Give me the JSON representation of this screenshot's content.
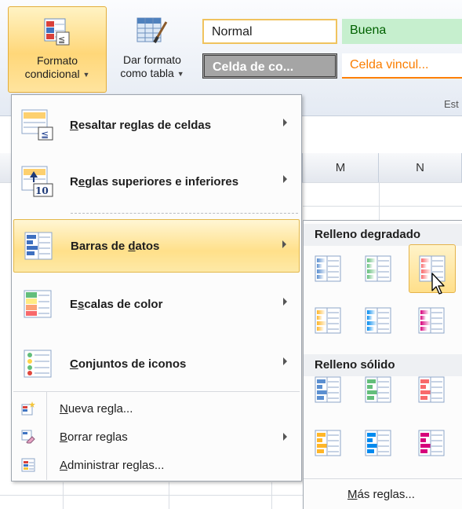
{
  "ribbon": {
    "formato_label_1": "Formato",
    "formato_label_2": "condicional",
    "dar_label_1": "Dar formato",
    "dar_label_2": "como tabla",
    "group_label": "Est"
  },
  "styles": {
    "normal": "Normal",
    "buena": "Buena",
    "celda": "Celda de co...",
    "vinculada": "Celda vincul..."
  },
  "columns": [
    "M",
    "N"
  ],
  "menu": {
    "items": [
      {
        "pre": "",
        "acc": "R",
        "post": "esaltar reglas de celdas",
        "icon": "highlight-cells-rules-icon"
      },
      {
        "pre": "R",
        "acc": "e",
        "post": "glas superiores e inferiores",
        "icon": "top-bottom-rules-icon"
      },
      {
        "pre": "Barras de ",
        "acc": "d",
        "post": "atos",
        "icon": "data-bars-icon"
      },
      {
        "pre": "E",
        "acc": "s",
        "post": "calas de color",
        "icon": "color-scales-icon"
      },
      {
        "pre": "",
        "acc": "C",
        "post": "onjuntos de iconos",
        "icon": "icon-sets-icon"
      }
    ],
    "small_items": [
      {
        "pre": "",
        "acc": "N",
        "post": "ueva regla...",
        "icon": "new-rule-icon"
      },
      {
        "pre": "",
        "acc": "B",
        "post": "orrar reglas",
        "icon": "clear-rules-icon"
      },
      {
        "pre": "",
        "acc": "A",
        "post": "dministrar reglas...",
        "icon": "manage-rules-icon"
      }
    ]
  },
  "submenu": {
    "gradient_header": "Relleno degradado",
    "solid_header": "Relleno sólido",
    "more_pre": "",
    "more_acc": "M",
    "more_post": "ás reglas...",
    "bar_colors": [
      "#5b8fd0",
      "#63be7b",
      "#f8696b",
      "#ffb628",
      "#008aef",
      "#d6007b"
    ]
  }
}
